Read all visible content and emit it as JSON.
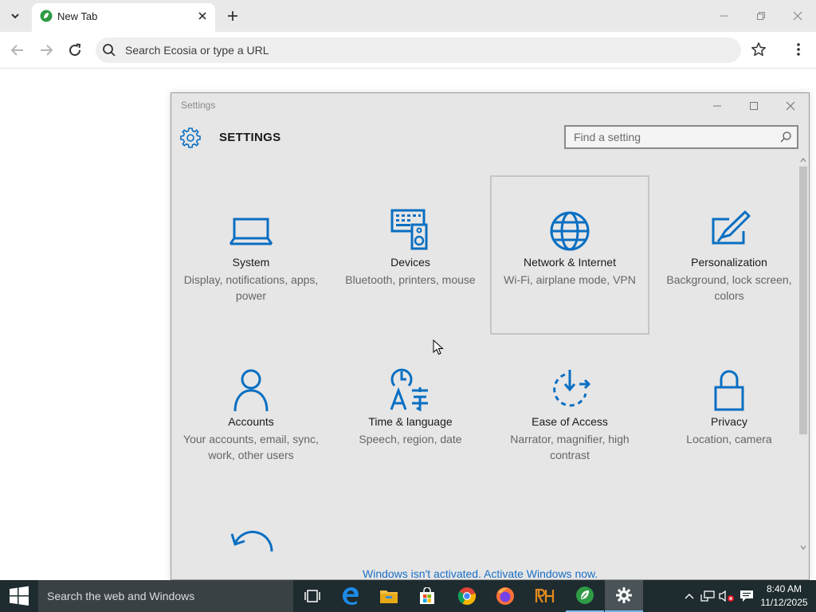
{
  "browser": {
    "tab": {
      "title": "New Tab"
    },
    "omnibox": {
      "placeholder": "Search Ecosia or type a URL"
    }
  },
  "settings": {
    "window_title": "Settings",
    "heading": "SETTINGS",
    "search_placeholder": "Find a setting",
    "tiles": [
      {
        "title": "System",
        "desc": "Display, notifications, apps, power",
        "icon": "laptop-icon"
      },
      {
        "title": "Devices",
        "desc": "Bluetooth, printers, mouse",
        "icon": "devices-icon"
      },
      {
        "title": "Network & Internet",
        "desc": "Wi-Fi, airplane mode, VPN",
        "icon": "globe-icon"
      },
      {
        "title": "Personalization",
        "desc": "Background, lock screen, colors",
        "icon": "paint-icon"
      },
      {
        "title": "Accounts",
        "desc": "Your accounts, email, sync, work, other users",
        "icon": "person-icon"
      },
      {
        "title": "Time & language",
        "desc": "Speech, region, date",
        "icon": "time-language-icon"
      },
      {
        "title": "Ease of Access",
        "desc": "Narrator, magnifier, high contrast",
        "icon": "ease-of-access-icon"
      },
      {
        "title": "Privacy",
        "desc": "Location, camera",
        "icon": "lock-icon"
      }
    ],
    "activation_notice": "Windows isn't activated. Activate Windows now."
  },
  "taskbar": {
    "search_placeholder": "Search the web and Windows",
    "apps": [
      "task-view",
      "edge",
      "file-explorer",
      "store",
      "chrome",
      "firefox",
      "rh",
      "ecosia",
      "settings"
    ],
    "time": "8:40 AM",
    "date": "11/12/2025"
  },
  "colors": {
    "accent": "#0a6fc2",
    "taskbar": "#1e2b2f",
    "window_bg": "#e6e6e6"
  }
}
